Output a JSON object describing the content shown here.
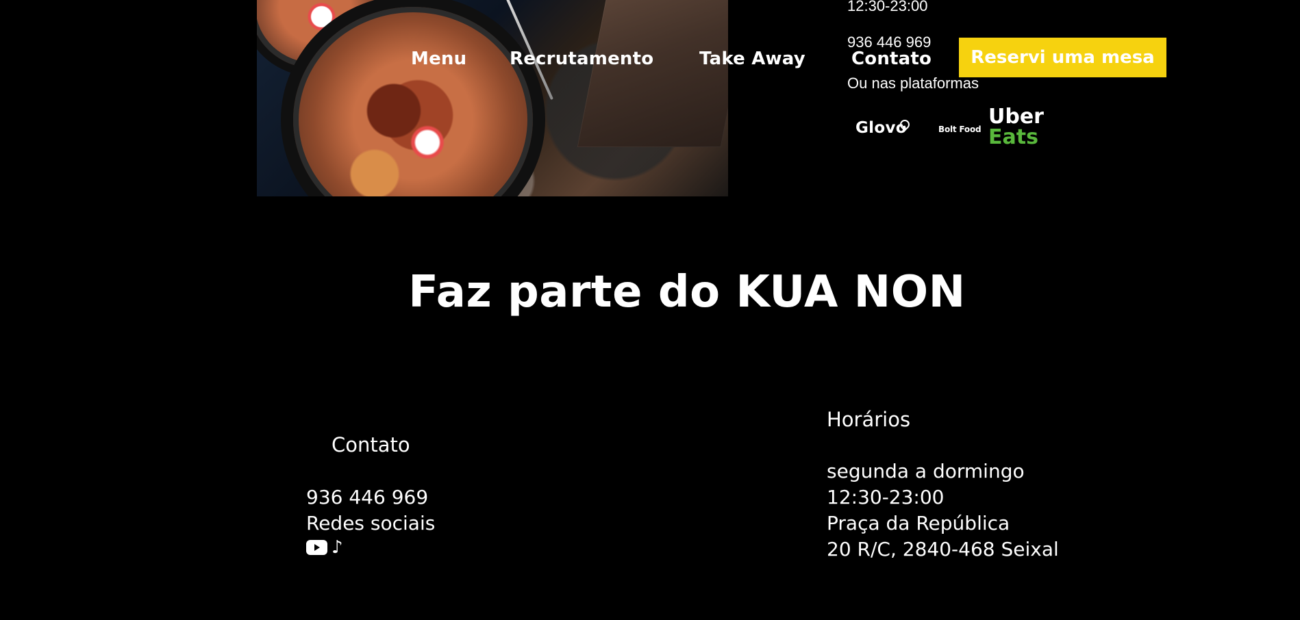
{
  "header": {
    "hours": "12:30-23:00",
    "phone": "936 446 969",
    "platforms_label": "Ou nas plataformas"
  },
  "navigation": {
    "items": [
      {
        "label": "Menu"
      },
      {
        "label": "Recrutamento"
      },
      {
        "label": "Take Away"
      },
      {
        "label": "Contato"
      }
    ],
    "reserve_button": "Reservi uma mesa"
  },
  "platforms": {
    "glovo": "Glovo",
    "bolt_food": "Bolt Food",
    "uber": "Uber",
    "eats": "Eats"
  },
  "hero": {
    "headline": "Faz parte do KUA NON"
  },
  "footer": {
    "contact": {
      "title": "Contato",
      "phone": "936 446 969",
      "social_label": "Redes sociais",
      "icons": [
        "youtube-icon",
        "tiktok-icon"
      ]
    },
    "hours": {
      "title": "Horários",
      "days": "segunda a dormingo",
      "time": "12:30-23:00",
      "address_line_1": "Praça da República",
      "address_line_2": "20 R/C, 2840-468 Seixal"
    }
  },
  "colors": {
    "background": "#000000",
    "text": "#ffffff",
    "accent": "#f6d20f",
    "uber_eats_green": "#59b83c"
  }
}
